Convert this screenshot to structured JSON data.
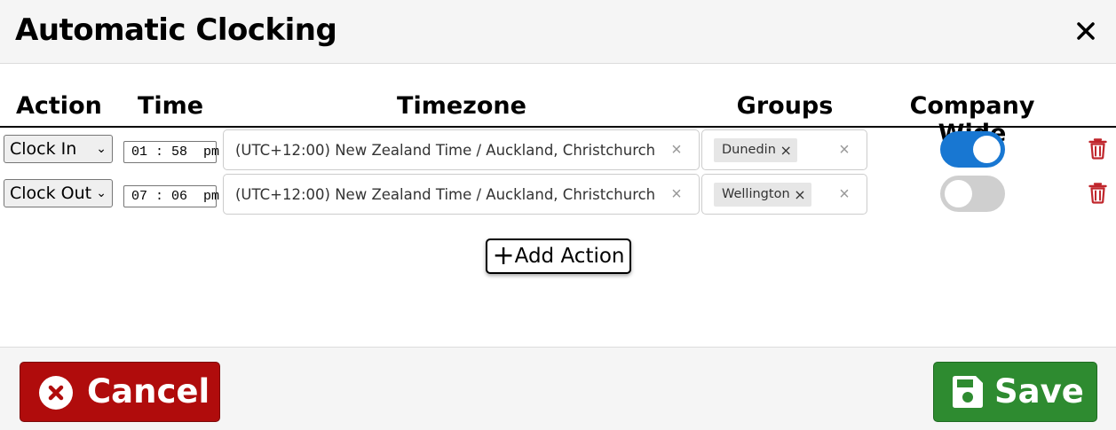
{
  "dialog": {
    "title": "Automatic Clocking"
  },
  "table": {
    "headers": {
      "action": "Action",
      "time": "Time",
      "timezone": "Timezone",
      "groups": "Groups",
      "company_wide": "Company Wide"
    },
    "rows": [
      {
        "action": "Clock In",
        "time": "01 : 58  pm",
        "timezone": "(UTC+12:00) New Zealand Time / Auckland, Christchurch",
        "groups": [
          "Dunedin"
        ],
        "company_wide": true
      },
      {
        "action": "Clock Out",
        "time": "07 : 06  pm",
        "timezone": "(UTC+12:00) New Zealand Time / Auckland, Christchurch",
        "groups": [
          "Wellington"
        ],
        "company_wide": false
      }
    ]
  },
  "add_action_label": "Add Action",
  "footer": {
    "cancel_label": "Cancel",
    "save_label": "Save"
  },
  "colors": {
    "toggle_on": "#1877d2",
    "toggle_off": "#cfcfcf",
    "delete_icon": "#c0262c",
    "cancel": "#b00c0c",
    "save": "#2e8b30"
  },
  "icons": {
    "close": "close-icon",
    "clear": "clear-x-icon",
    "chip_remove": "chip-remove-icon",
    "delete": "trash-icon",
    "add": "plus-icon",
    "cancel": "times-circle-icon",
    "save": "floppy-disk-icon",
    "dropdown": "chevron-down-icon"
  }
}
